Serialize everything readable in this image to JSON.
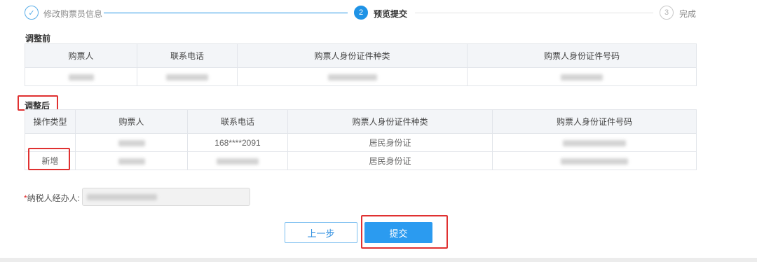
{
  "steps": [
    {
      "number": "✓",
      "label": "修改购票员信息",
      "state": "done"
    },
    {
      "number": "2",
      "label": "预览提交",
      "state": "active"
    },
    {
      "number": "3",
      "label": "完成",
      "state": "todo"
    }
  ],
  "before": {
    "title": "调整前",
    "headers": [
      "购票人",
      "联系电话",
      "购票人身份证件种类",
      "购票人身份证件号码"
    ]
  },
  "after": {
    "title": "调整后",
    "headers": [
      "操作类型",
      "购票人",
      "联系电话",
      "购票人身份证件种类",
      "购票人身份证件号码"
    ],
    "rows": [
      {
        "op": "",
        "phone": "168****2091",
        "id_type": "居民身份证"
      },
      {
        "op": "新增",
        "phone": "",
        "id_type": "居民身份证"
      }
    ]
  },
  "agent": {
    "label": "纳税人经办人:",
    "required_mark": "*"
  },
  "buttons": {
    "prev": "上一步",
    "submit": "提交"
  },
  "colors": {
    "accent": "#1f93e6",
    "highlight": "#e03131",
    "header_bg": "#f3f5f8"
  }
}
